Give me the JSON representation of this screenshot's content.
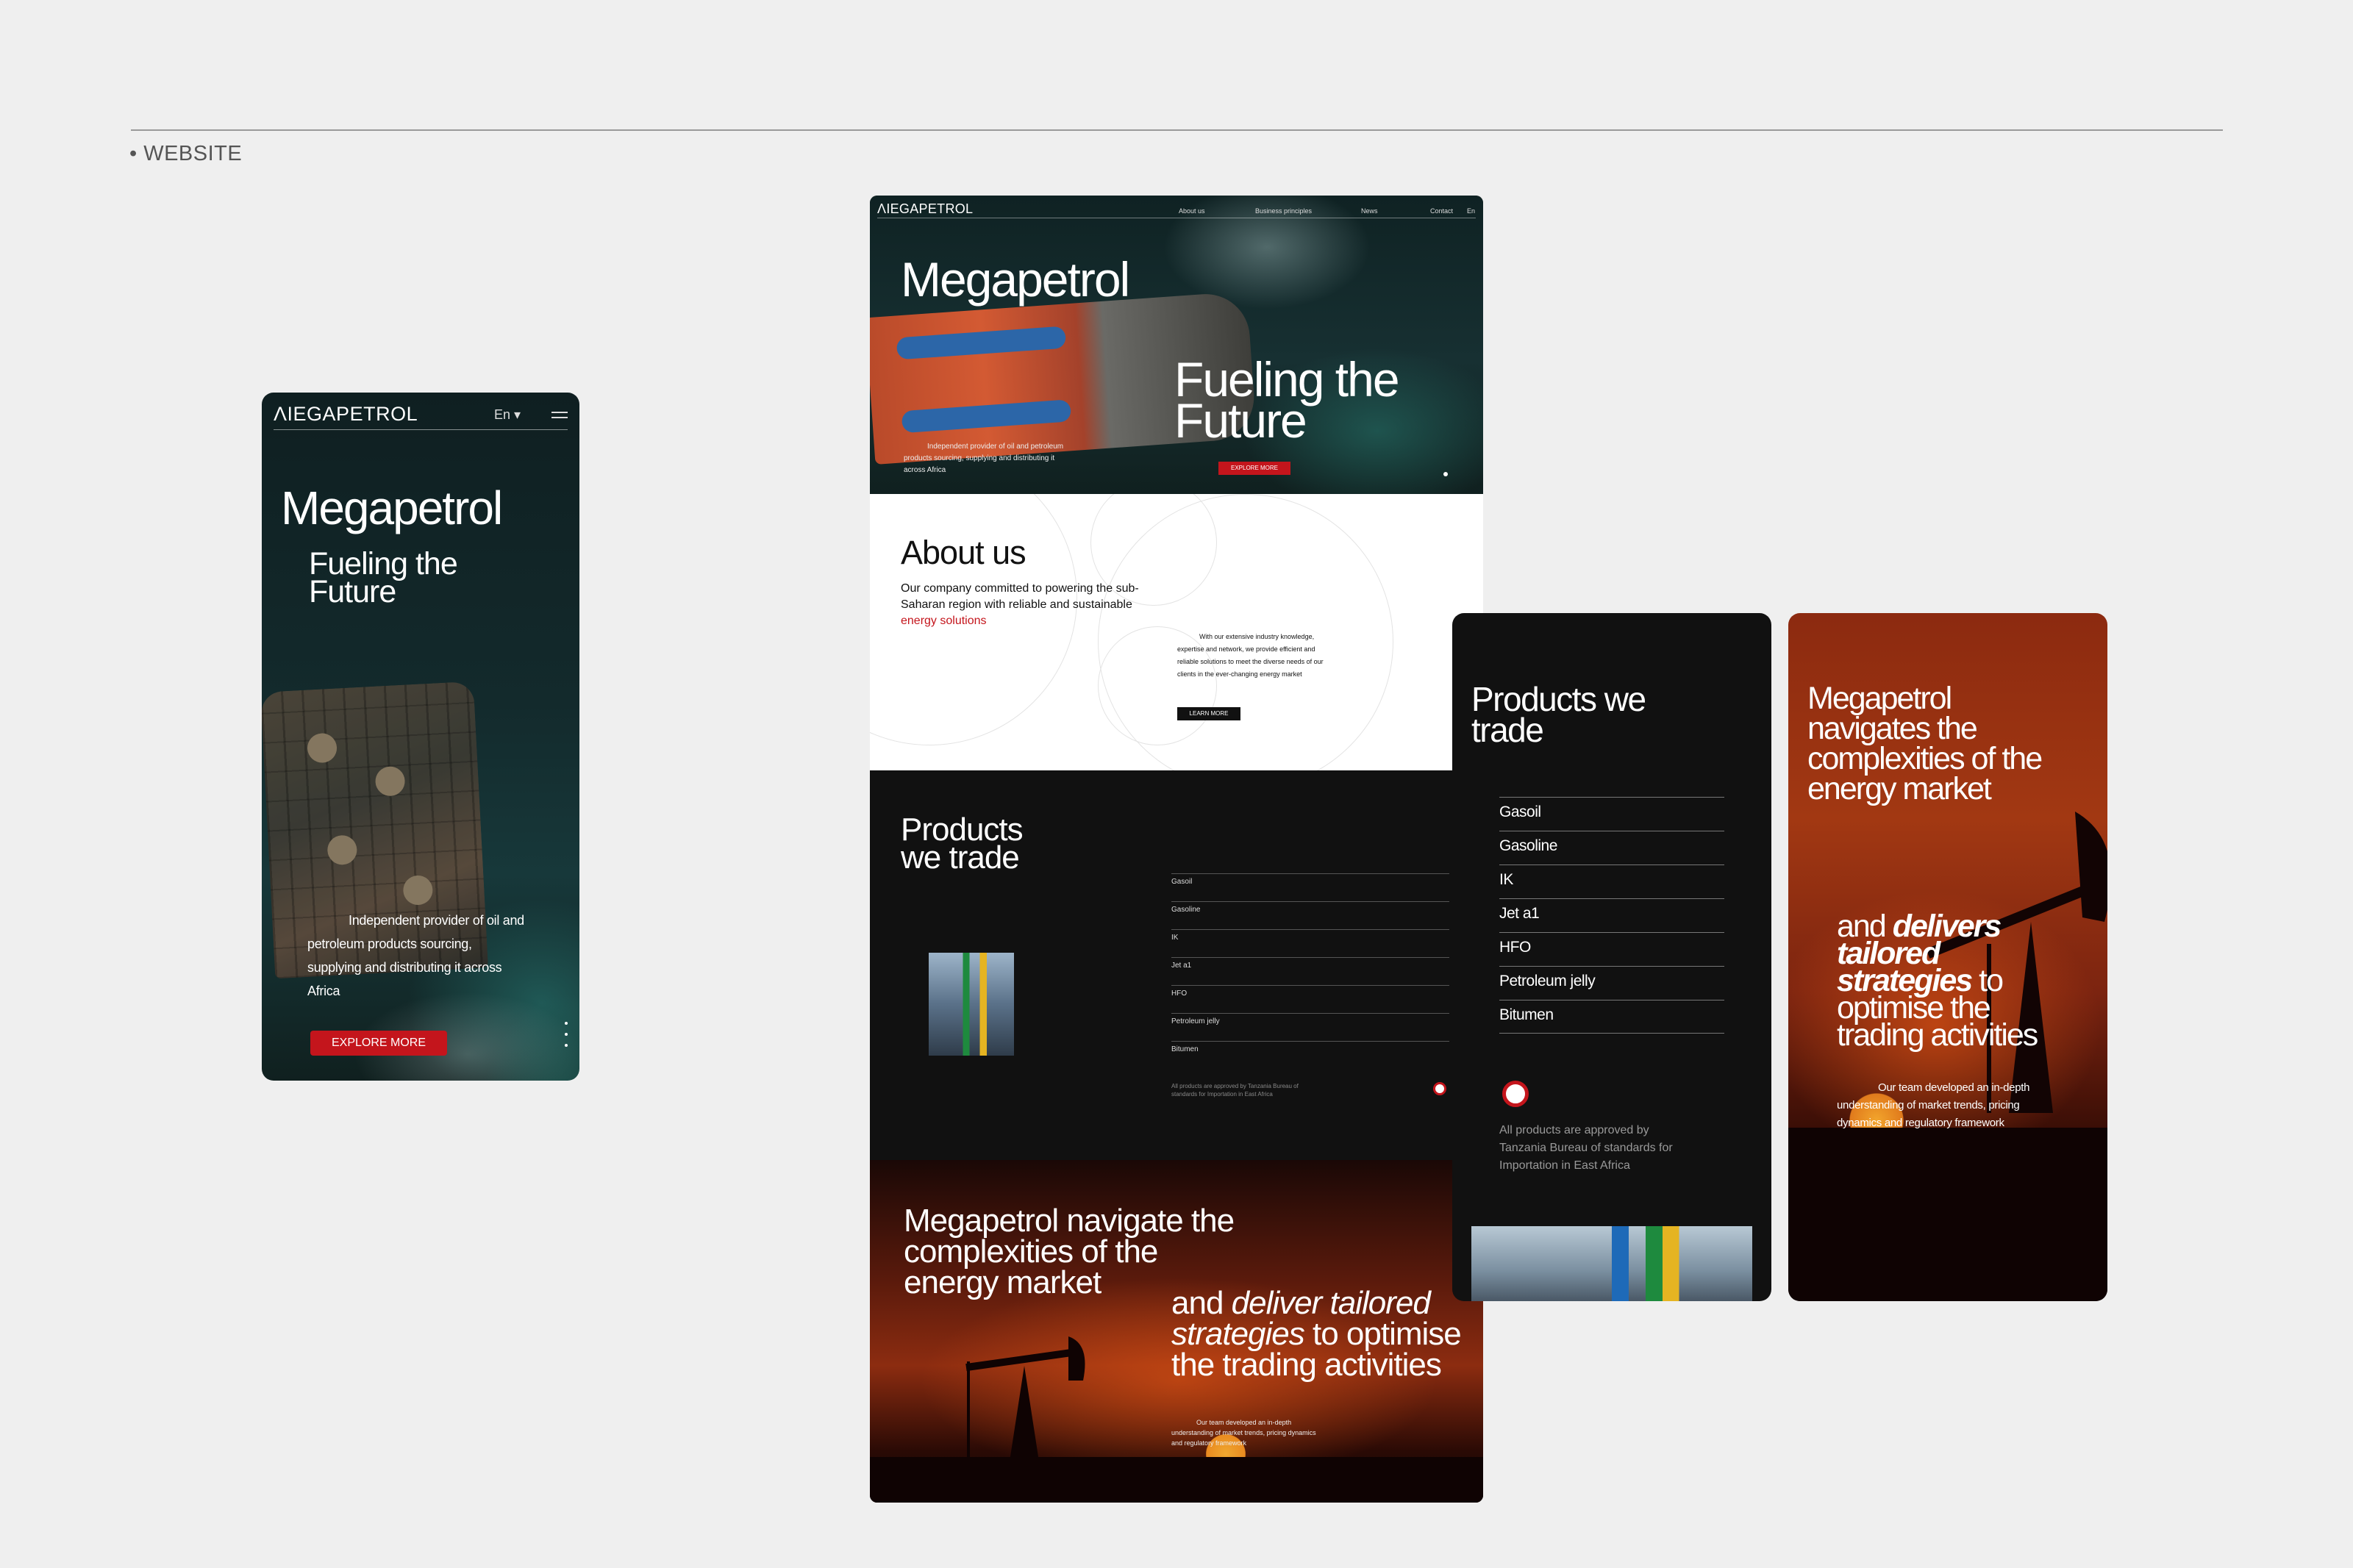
{
  "section_label": "• WEBSITE",
  "brand": {
    "logo": "ΛIEGAPETROL",
    "name": "Megapetrol",
    "tagline": "Fueling the Future",
    "accent_color": "#c4151c"
  },
  "mobile_hero": {
    "lang": "En ▾",
    "description": "Independent provider of oil and petroleum products sourcing, supplying and distributing it across Africa",
    "cta": "EXPLORE MORE"
  },
  "desktop": {
    "nav": [
      "About us",
      "Business principles",
      "News",
      "Contact",
      "En"
    ],
    "hero_description": "Independent provider of oil and petroleum products sourcing, supplying and distributing it across Africa",
    "cta": "EXPLORE MORE",
    "about": {
      "title": "About us",
      "text": "Our company committed to powering the sub-Saharan region with reliable and sustainable",
      "text_red": "energy solutions",
      "side_text": "With our extensive industry knowledge, expertise and network, we provide efficient and reliable solutions to meet the diverse needs of our clients in the ever-changing energy market",
      "button": "LEARN MORE"
    },
    "products": {
      "title": "Products we trade",
      "items": [
        "Gasoil",
        "Gasoline",
        "IK",
        "Jet a1",
        "HFO",
        "Petroleum jelly",
        "Bitumen"
      ],
      "approved": "All products are approved by Tanzania Bureau of standards for Importation in East Africa"
    },
    "market": {
      "title": "Megapetrol navigate the complexities of the energy market",
      "sub_plain_1": "and ",
      "sub_italic": "deliver tailored strategies",
      "sub_plain_2": " to optimise the trading activities",
      "description": "Our team developed an in-depth understanding of market trends, pricing dynamics and regulatory framework"
    }
  },
  "mobile_products": {
    "title": "Products we trade",
    "items": [
      "Gasoil",
      "Gasoline",
      "IK",
      "Jet a1",
      "HFO",
      "Petroleum jelly",
      "Bitumen"
    ],
    "approved": "All products are approved by Tanzania Bureau of standards for Importation in East Africa"
  },
  "mobile_market": {
    "title": "Megapetrol navigates the complexities of the energy market",
    "sub_plain_1": "and ",
    "sub_bold": "delivers tailored strategies",
    "sub_plain_2": " to optimise the trading activities",
    "description": "Our team developed an in-depth understanding of market trends, pricing dynamics and regulatory framework"
  }
}
